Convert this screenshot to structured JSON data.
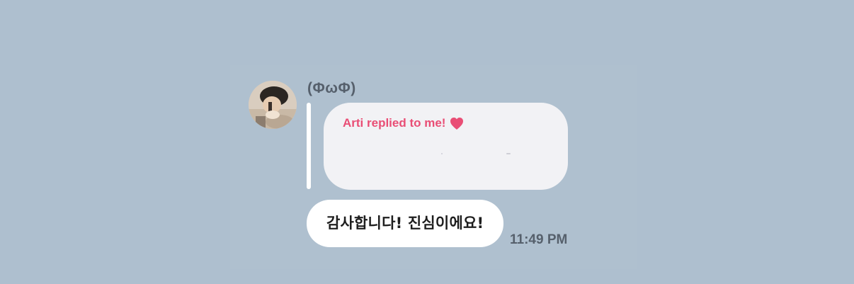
{
  "sender": {
    "name": "(ΦωΦ)"
  },
  "quoted_message": {
    "text": "Arti replied to me!",
    "icon": "heart-icon",
    "color": "#e94e75"
  },
  "message": {
    "text": "감사합니다! 진심이에요!",
    "time": "11:49 PM"
  },
  "colors": {
    "background": "#aebfcf",
    "bubble": "#ffffff",
    "quoted_bubble": "#f2f2f5",
    "name_text": "#56606c"
  }
}
